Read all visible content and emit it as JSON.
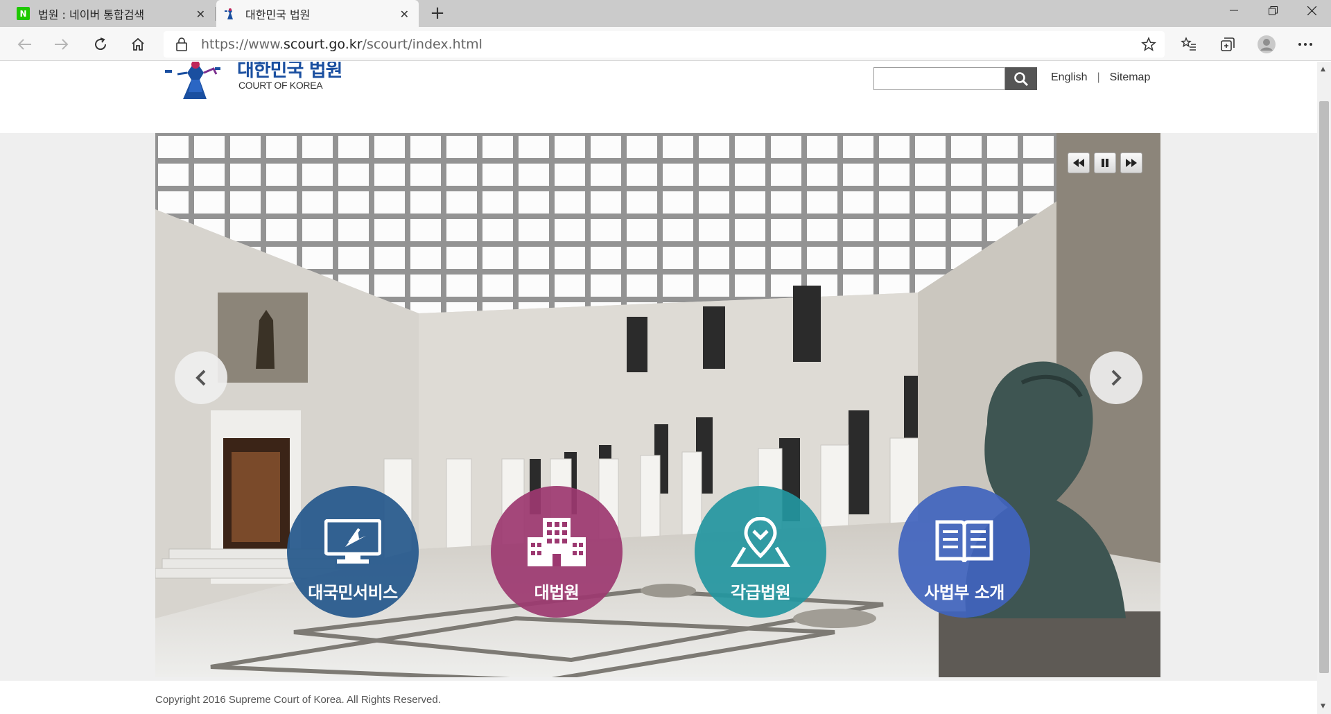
{
  "browser": {
    "tabs": [
      {
        "title": "법원 : 네이버 통합검색",
        "favicon": "naver-icon"
      },
      {
        "title": "대한민국 법원",
        "favicon": "court-icon"
      }
    ],
    "url": {
      "prefix": "https://www.",
      "domain": "scourt.go.kr",
      "path": "/scourt/index.html"
    }
  },
  "header": {
    "logo_kr": "대한민국 법원",
    "logo_en": "COURT OF KOREA",
    "search_placeholder": "",
    "links": {
      "english": "English",
      "separator": "|",
      "sitemap": "Sitemap"
    }
  },
  "hero": {
    "services": [
      {
        "label": "대국민서비스",
        "icon": "monitor-icon",
        "color": "#26588c"
      },
      {
        "label": "대법원",
        "icon": "building-icon",
        "color": "#9c3870"
      },
      {
        "label": "각급법원",
        "icon": "map-pin-icon",
        "color": "#2396a0"
      },
      {
        "label": "사법부 소개",
        "icon": "book-icon",
        "color": "#4064be"
      }
    ]
  },
  "footer": {
    "copyright": "Copyright 2016 Supreme Court of Korea. All Rights Reserved."
  }
}
